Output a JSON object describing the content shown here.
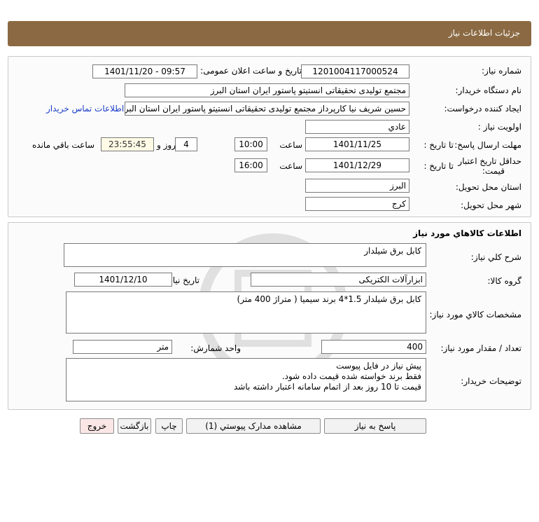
{
  "header": {
    "title": "جزئیات اطلاعات نیاز"
  },
  "need_info": {
    "need_number_label": "شماره نیاز:",
    "need_number": "1201004117000524",
    "announce_label": "تاریخ و ساعت اعلان عمومی:",
    "announce_value": "1401/11/20 - 09:57",
    "buyer_org_label": "نام دستگاه خریدار:",
    "buyer_org": "مجتمع تولیدی تحقیقاتی انستیتو پاستور ایران استان البرز",
    "requester_label": "ایجاد کننده درخواست:",
    "requester": "حسین شریف نیا کارپرداز مجتمع تولیدی تحقیقاتی انستیتو پاستور ایران استان البرز",
    "contact_link": "اطلاعات تماس خریدار",
    "priority_label": "اولویت نیاز :",
    "priority": "عادي",
    "deadline_label": "مهلت ارسال پاسخ:",
    "to_date_label": "تا تاریخ :",
    "deadline_date": "1401/11/25",
    "time_label": "ساعت",
    "deadline_time": "10:00",
    "days_value": "4",
    "days_label": "روز و",
    "remaining_time": "23:55:45",
    "remaining_label": "ساعت باقي مانده",
    "validity_label_1": "حداقل تاریخ اعتبار",
    "validity_label_2": "قیمت:",
    "validity_to_label": "تا تاریخ :",
    "validity_date": "1401/12/29",
    "validity_time_label": "ساعت",
    "validity_time": "16:00",
    "province_label": "استان محل تحویل:",
    "province": "البرز",
    "city_label": "شهر محل تحویل:",
    "city": "کرج"
  },
  "goods": {
    "section_title": "اطلاعات کالاهاي مورد نياز",
    "general_desc_label": "شرح کلي نياز:",
    "general_desc": "کابل برق شیلدار",
    "group_label": "گروه کالا:",
    "group": "ابزارآلات الکتریکی",
    "need_date_label": "تاریخ نیاز به کالا:",
    "need_date": "1401/12/10",
    "specs_label": "مشخصات کالاي مورد نياز:",
    "specs": "کابل برق شیلدار 1.5*4 برند سیمیا ( متراژ 400 متر)",
    "qty_label": "تعداد / مقدار مورد نیاز:",
    "qty": "400",
    "unit_label": "واحد شمارش:",
    "unit": "متر",
    "buyer_notes_label": "توضیحات خریدار:",
    "buyer_notes": [
      "پیش نیاز در فایل پیوست",
      "فقط برند خواسته شده قیمت داده شود.",
      "قیمت تا 10 روز بعد از اتمام سامانه اعتبار داشته باشد"
    ]
  },
  "buttons": {
    "reply": "پاسخ به نياز",
    "attachments": "مشاهده مدارک پیوستي (1)",
    "print": "چاپ",
    "back": "بازگشت",
    "exit": "خروج"
  },
  "colors": {
    "header_bg": "#8b6a43",
    "exit_bg": "#fbe6e6",
    "link": "#1a3cc9"
  }
}
